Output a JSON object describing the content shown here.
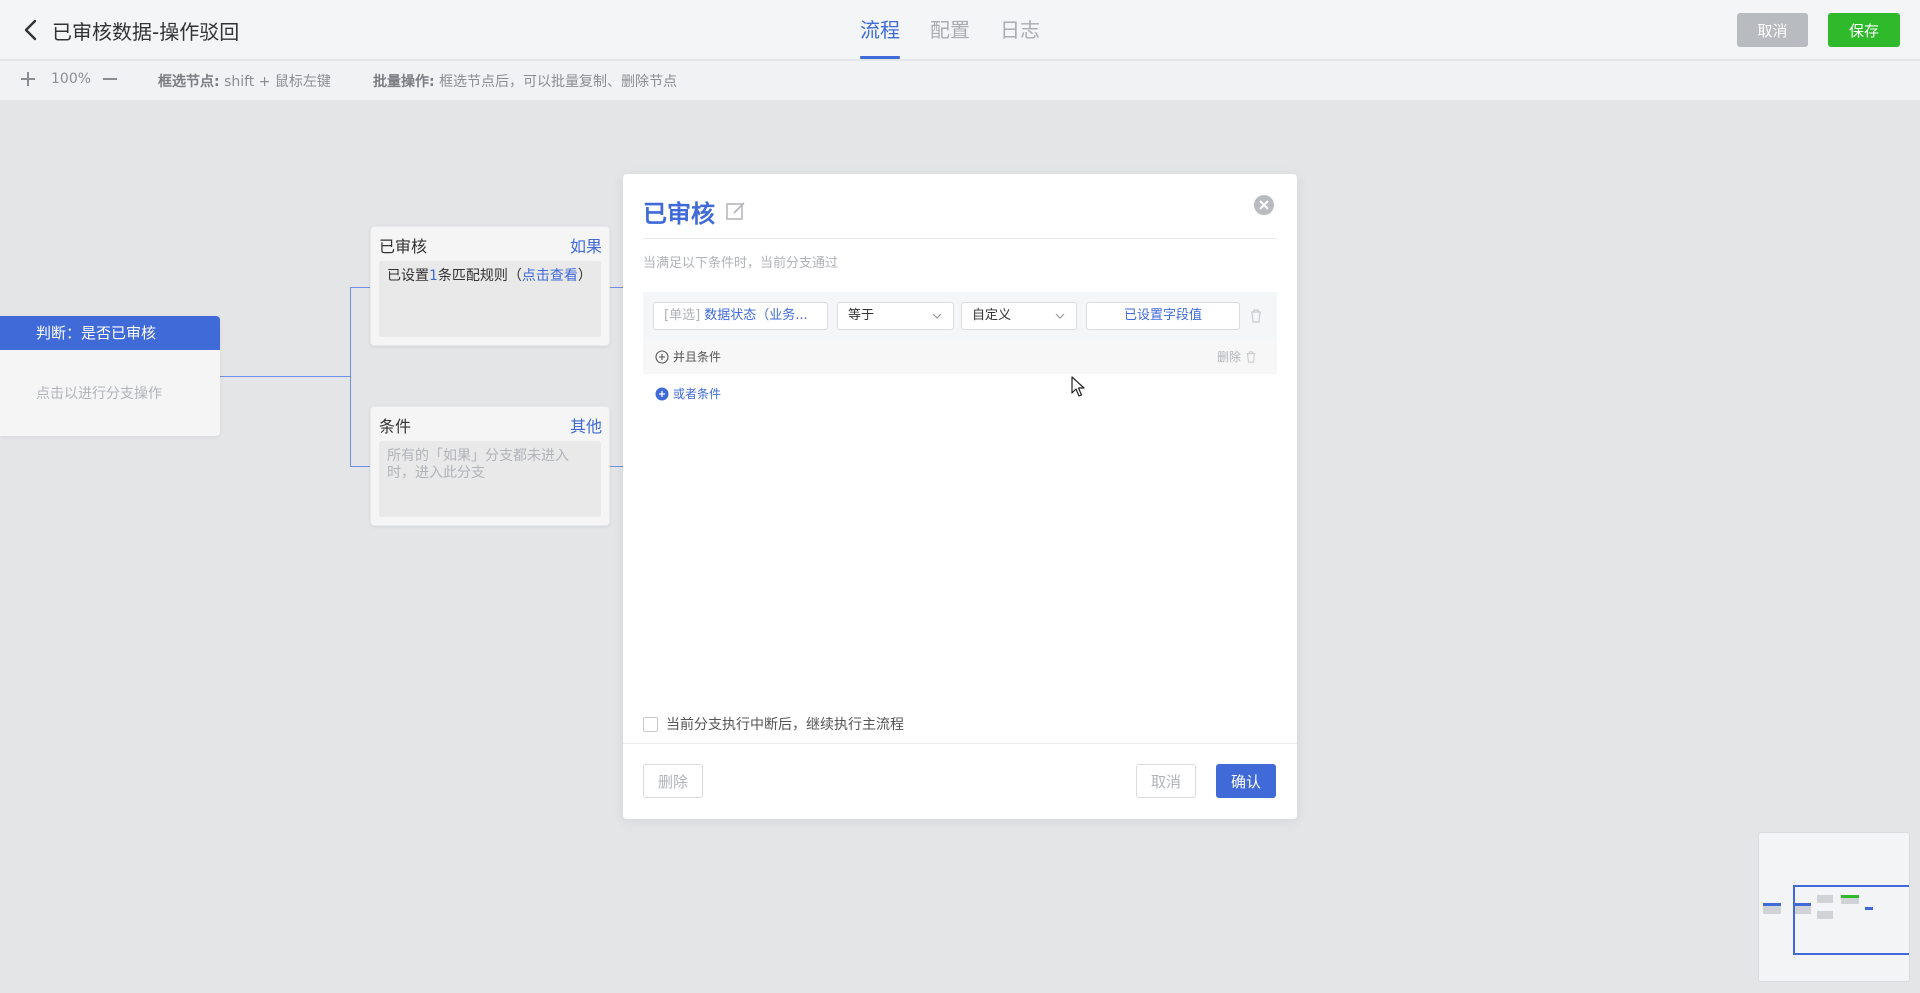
{
  "header": {
    "title": "已审核数据-操作驳回",
    "tabs": [
      {
        "label": "流程",
        "active": true
      },
      {
        "label": "配置",
        "active": false
      },
      {
        "label": "日志",
        "active": false
      }
    ],
    "cancel_label": "取消",
    "save_label": "保存"
  },
  "toolbar": {
    "zoom_level": "100%",
    "hint1_label": "框选节点:",
    "hint1_text": "shift + 鼠标左键",
    "hint2_label": "批量操作:",
    "hint2_text": "框选节点后，可以批量复制、删除节点"
  },
  "canvas": {
    "judge_node": {
      "title": "判断：是否已审核",
      "body": "点击以进行分支操作"
    },
    "branches": [
      {
        "title": "已审核",
        "tag": "如果",
        "body_prefix": "已设置",
        "body_count": "1",
        "body_mid": "条匹配规则（",
        "body_link": "点击查看",
        "body_suffix": "）"
      },
      {
        "title": "条件",
        "tag": "其他",
        "body": "所有的「如果」分支都未进入时，进入此分支"
      }
    ]
  },
  "dialog": {
    "title": "已审核",
    "subtitle": "当满足以下条件时，当前分支通过",
    "condition": {
      "field_tag": "[单选]",
      "field_name": "数据状态（业务...",
      "operator": "等于",
      "value_type": "自定义",
      "value": "已设置字段值"
    },
    "and_condition_label": "并且条件",
    "delete_label": "删除",
    "or_condition_label": "或者条件",
    "continue_checkbox_label": "当前分支执行中断后，继续执行主流程",
    "continue_checked": false,
    "btn_delete": "删除",
    "btn_cancel": "取消",
    "btn_confirm": "确认"
  },
  "colors": {
    "primary": "#3f6ad8",
    "save_green": "#2fba2c",
    "muted_button": "#b8bbbf"
  }
}
